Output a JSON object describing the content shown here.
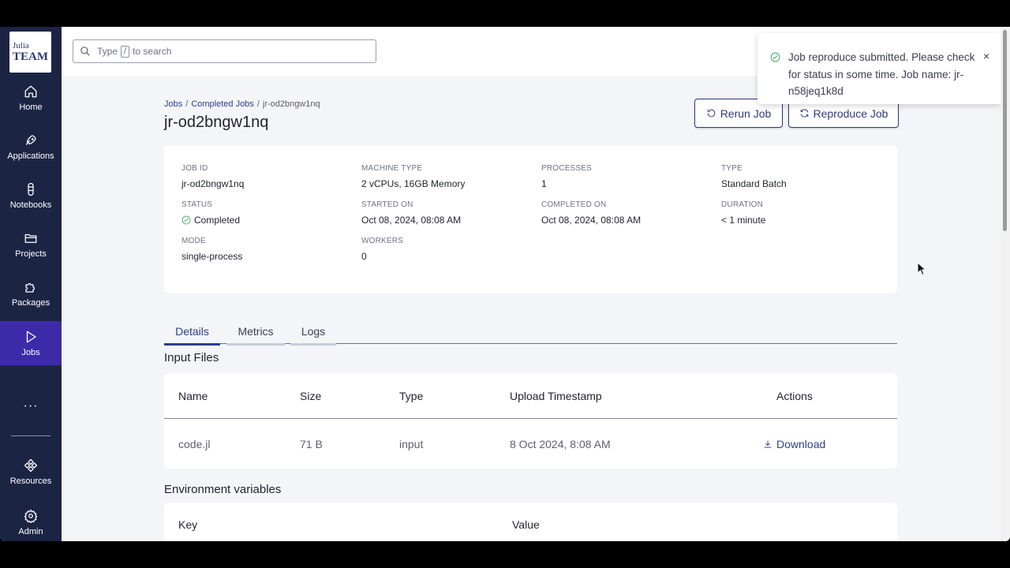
{
  "sidebar": {
    "logo_top": "Julia",
    "logo_bottom": "TEAM",
    "items": [
      {
        "label": "Home",
        "icon": "home-icon"
      },
      {
        "label": "Applications",
        "icon": "rocket-icon"
      },
      {
        "label": "Notebooks",
        "icon": "notebook-icon"
      },
      {
        "label": "Projects",
        "icon": "folder-icon"
      },
      {
        "label": "Packages",
        "icon": "puzzle-icon"
      },
      {
        "label": "Jobs",
        "icon": "play-icon"
      },
      {
        "label": "Resources",
        "icon": "resources-icon"
      },
      {
        "label": "Admin",
        "icon": "gear-icon"
      }
    ],
    "more": "···",
    "accent": "#3d2aa8",
    "bg": "#1c2444"
  },
  "search": {
    "prefix": "Type",
    "key": "/",
    "suffix": "to search"
  },
  "breadcrumb": {
    "jobs": "Jobs",
    "completed": "Completed Jobs",
    "current": "jr-od2bngw1nq",
    "sep": "/"
  },
  "page": {
    "title": "jr-od2bngw1nq",
    "rerun_label": "Rerun Job",
    "reproduce_label": "Reproduce Job"
  },
  "details": {
    "job_id": {
      "k": "JOB ID",
      "v": "jr-od2bngw1nq"
    },
    "machine_type": {
      "k": "MACHINE TYPE",
      "v": "2 vCPUs, 16GB Memory"
    },
    "processes": {
      "k": "PROCESSES",
      "v": "1"
    },
    "type": {
      "k": "TYPE",
      "v": "Standard Batch"
    },
    "status": {
      "k": "STATUS",
      "v": "Completed"
    },
    "started_on": {
      "k": "STARTED ON",
      "v": "Oct 08, 2024, 08:08 AM"
    },
    "completed_on": {
      "k": "COMPLETED ON",
      "v": "Oct 08, 2024, 08:08 AM"
    },
    "duration": {
      "k": "DURATION",
      "v": "< 1 minute"
    },
    "mode": {
      "k": "MODE",
      "v": "single-process"
    },
    "workers": {
      "k": "WORKERS",
      "v": "0"
    }
  },
  "tabs": [
    "Details",
    "Metrics",
    "Logs"
  ],
  "input_files": {
    "heading": "Input Files",
    "columns": [
      "Name",
      "Size",
      "Type",
      "Upload Timestamp",
      "Actions"
    ],
    "rows": [
      {
        "name": "code.jl",
        "size": "71 B",
        "type": "input",
        "timestamp": "8 Oct 2024, 8:08 AM",
        "action": "Download"
      }
    ]
  },
  "env_vars": {
    "heading": "Environment variables",
    "columns": [
      "Key",
      "Value"
    ]
  },
  "toast": {
    "message": "Job reproduce submitted. Please check for status in some time. Job name: jr-n58jeq1k8d",
    "close": "×"
  }
}
